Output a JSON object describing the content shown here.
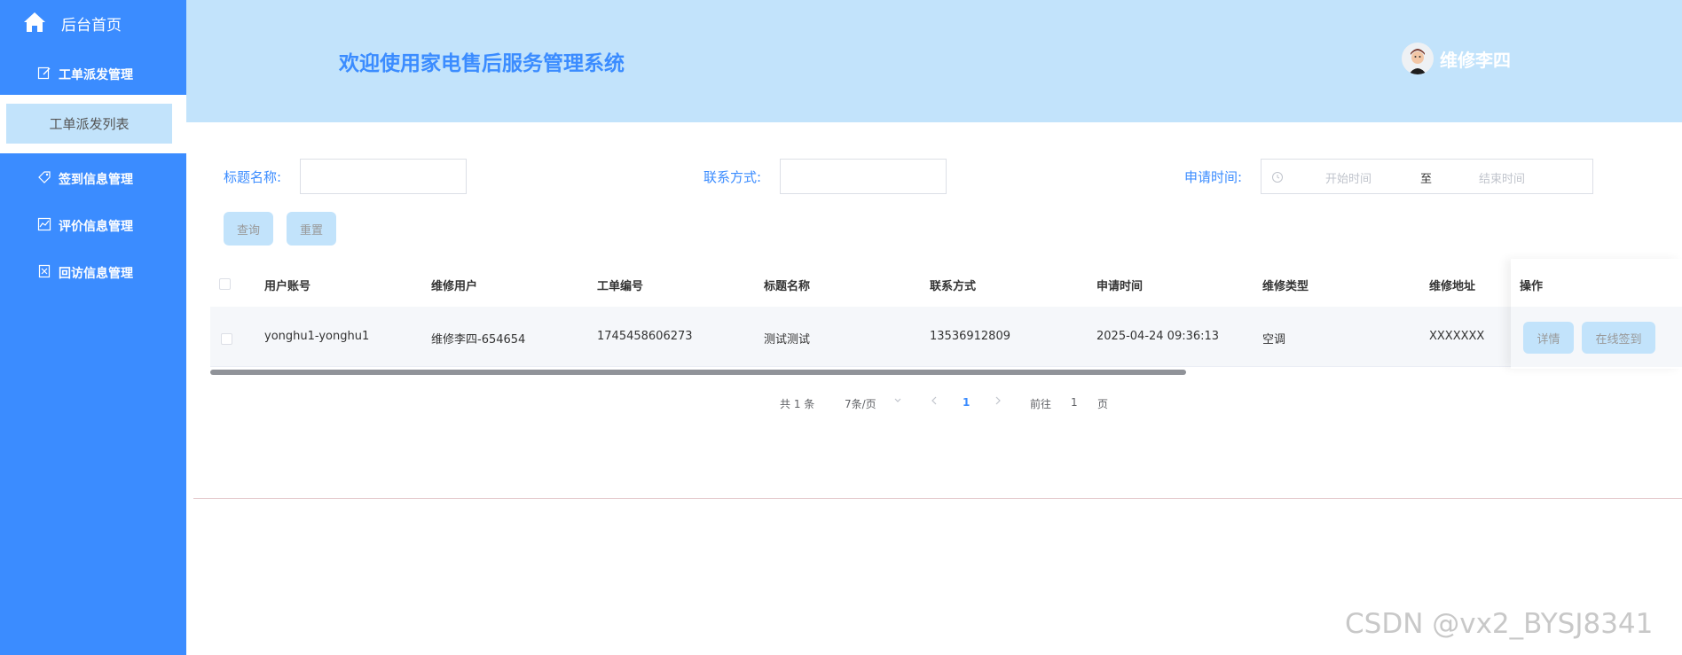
{
  "sidebar": {
    "home_label": "后台首页",
    "groups": [
      {
        "label": "工单派发管理",
        "icon": "edit-icon"
      },
      {
        "label": "签到信息管理",
        "icon": "tag-icon"
      },
      {
        "label": "评价信息管理",
        "icon": "chart-icon"
      },
      {
        "label": "回访信息管理",
        "icon": "document-icon"
      }
    ],
    "active_submenu": "工单派发列表"
  },
  "header": {
    "title": "欢迎使用家电售后服务管理系统",
    "username": "维修李四"
  },
  "search": {
    "title_label": "标题名称:",
    "title_value": "",
    "contact_label": "联系方式:",
    "contact_value": "",
    "date_label": "申请时间:",
    "date_start_placeholder": "开始时间",
    "date_separator": "至",
    "date_end_placeholder": "结束时间",
    "query_button": "查询",
    "reset_button": "重置"
  },
  "table": {
    "columns": [
      "用户账号",
      "维修用户",
      "工单编号",
      "标题名称",
      "联系方式",
      "申请时间",
      "维修类型",
      "维修地址",
      "操作"
    ],
    "rows": [
      {
        "account": "yonghu1-yonghu1",
        "repair_user": "维修李四-654654",
        "order_no": "1745458606273",
        "title": "测试测试",
        "contact": "13536912809",
        "apply_time": "2025-04-24 09:36:13",
        "repair_type": "空调",
        "address": "XXXXXXX",
        "actions": [
          "详情",
          "在线签到"
        ]
      }
    ]
  },
  "pagination": {
    "total": "共 1 条",
    "page_size": "7条/页",
    "current_page": "1",
    "goto_label": "前往",
    "goto_value": "1",
    "page_suffix": "页"
  },
  "watermark": "CSDN @vx2_BYSJ8341",
  "colors": {
    "sidebar": "#3b8cff",
    "header": "#c2e3fb",
    "accent": "#3b8cff"
  }
}
